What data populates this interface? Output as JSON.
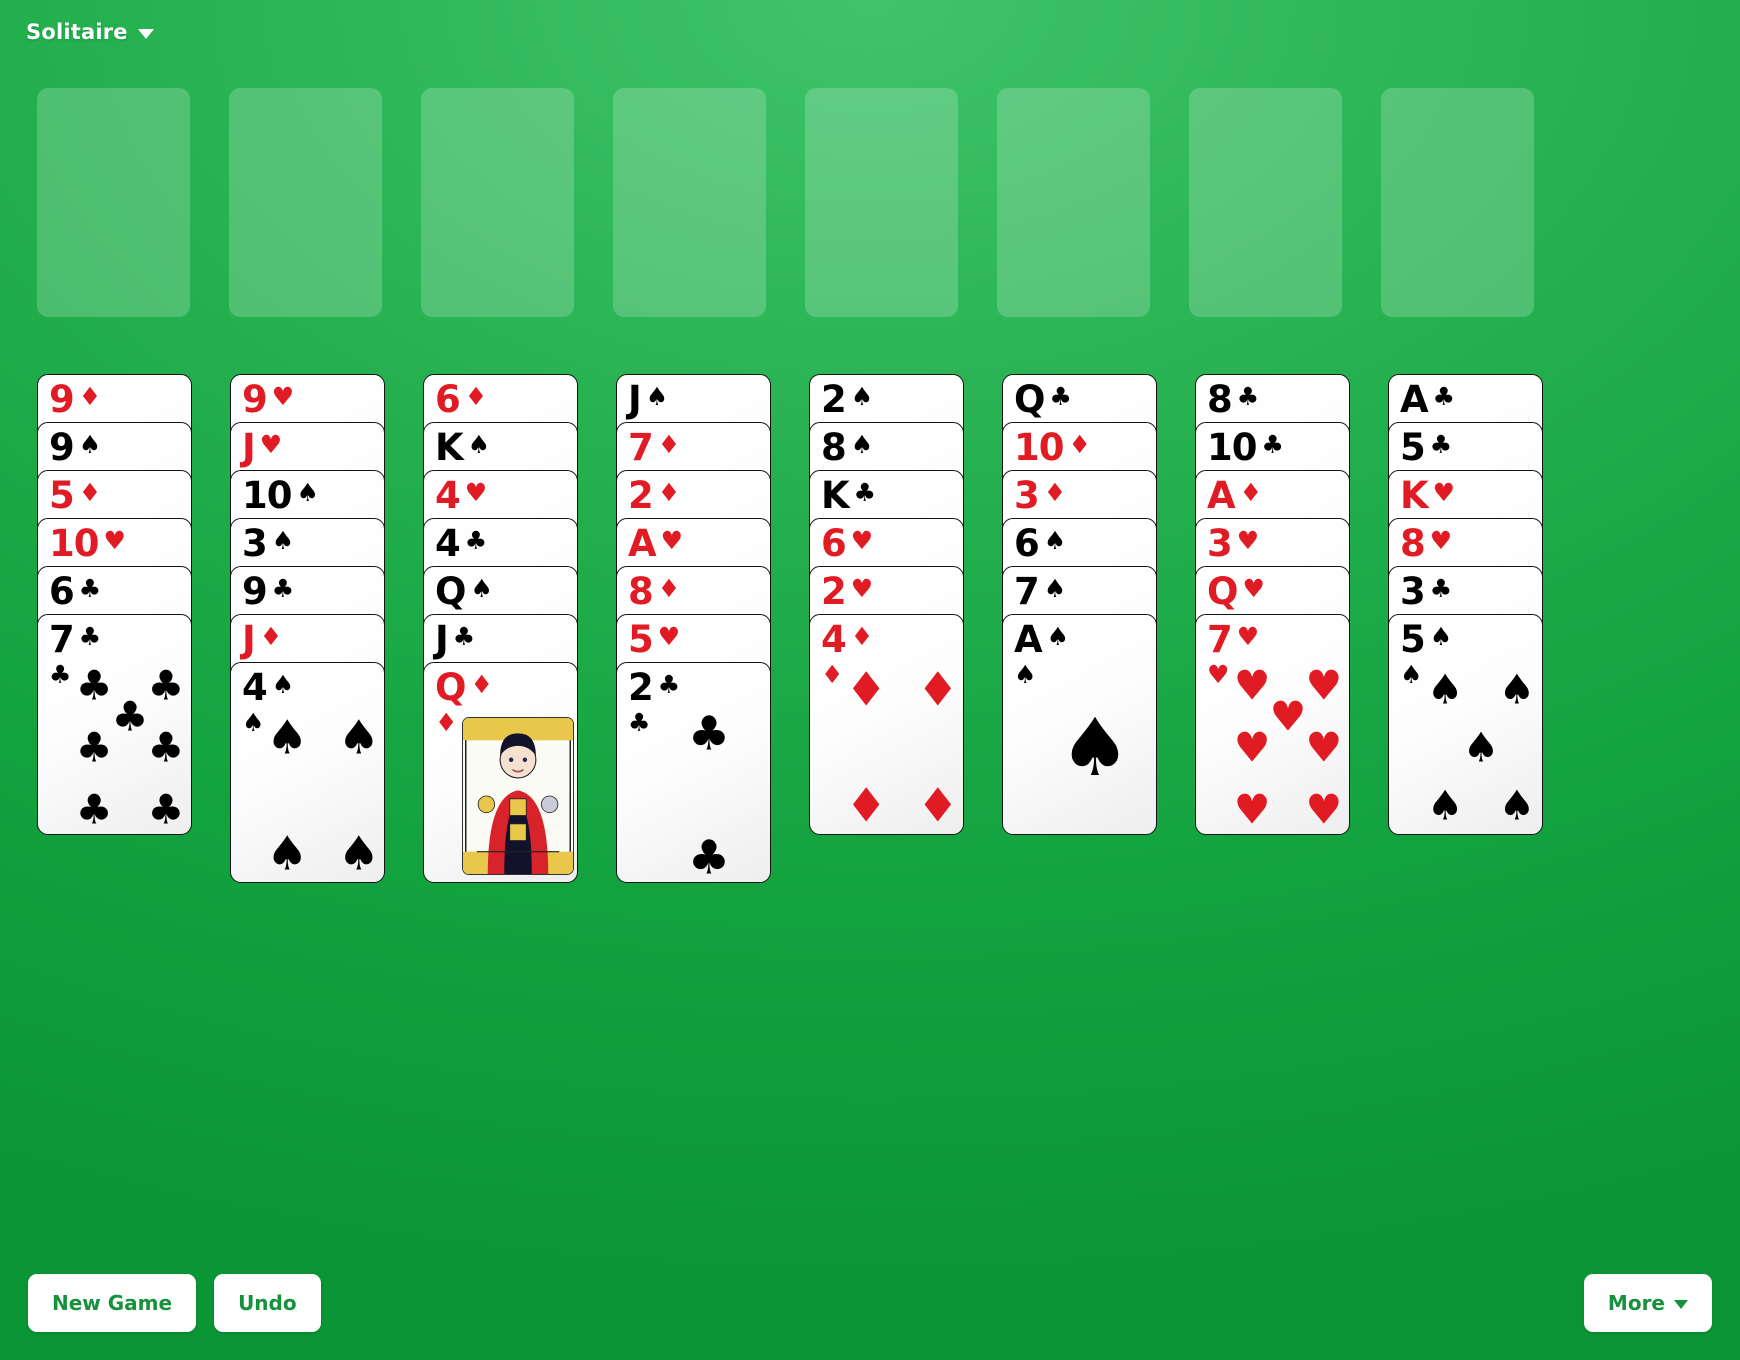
{
  "header": {
    "title": "Solitaire",
    "menu_caret": "chevron-down-icon"
  },
  "free_cells": {
    "count": 8,
    "cards": [
      null,
      null,
      null,
      null,
      null,
      null,
      null,
      null
    ]
  },
  "footer": {
    "new_game_label": "New Game",
    "undo_label": "Undo",
    "more_label": "More"
  },
  "colors": {
    "table_green": "#13a33f",
    "card_white": "#ffffff",
    "red_suit": "#e01b24",
    "black_suit": "#000000",
    "button_text": "#16913c"
  },
  "game": {
    "type": "freecell",
    "columns": [
      {
        "index": 1,
        "cards": [
          {
            "rank": "9",
            "suit": "♦",
            "suit_name": "diamonds",
            "color": "red"
          },
          {
            "rank": "9",
            "suit": "♠",
            "suit_name": "spades",
            "color": "black"
          },
          {
            "rank": "5",
            "suit": "♦",
            "suit_name": "diamonds",
            "color": "red"
          },
          {
            "rank": "10",
            "suit": "♥",
            "suit_name": "hearts",
            "color": "red"
          },
          {
            "rank": "6",
            "suit": "♣",
            "suit_name": "clubs",
            "color": "black"
          },
          {
            "rank": "7",
            "suit": "♣",
            "suit_name": "clubs",
            "color": "black"
          }
        ]
      },
      {
        "index": 2,
        "cards": [
          {
            "rank": "9",
            "suit": "♥",
            "suit_name": "hearts",
            "color": "red"
          },
          {
            "rank": "J",
            "suit": "♥",
            "suit_name": "hearts",
            "color": "red"
          },
          {
            "rank": "10",
            "suit": "♠",
            "suit_name": "spades",
            "color": "black"
          },
          {
            "rank": "3",
            "suit": "♠",
            "suit_name": "spades",
            "color": "black"
          },
          {
            "rank": "9",
            "suit": "♣",
            "suit_name": "clubs",
            "color": "black"
          },
          {
            "rank": "J",
            "suit": "♦",
            "suit_name": "diamonds",
            "color": "red"
          },
          {
            "rank": "4",
            "suit": "♠",
            "suit_name": "spades",
            "color": "black"
          }
        ]
      },
      {
        "index": 3,
        "cards": [
          {
            "rank": "6",
            "suit": "♦",
            "suit_name": "diamonds",
            "color": "red"
          },
          {
            "rank": "K",
            "suit": "♠",
            "suit_name": "spades",
            "color": "black"
          },
          {
            "rank": "4",
            "suit": "♥",
            "suit_name": "hearts",
            "color": "red"
          },
          {
            "rank": "4",
            "suit": "♣",
            "suit_name": "clubs",
            "color": "black"
          },
          {
            "rank": "Q",
            "suit": "♠",
            "suit_name": "spades",
            "color": "black"
          },
          {
            "rank": "J",
            "suit": "♣",
            "suit_name": "clubs",
            "color": "black"
          },
          {
            "rank": "Q",
            "suit": "♦",
            "suit_name": "diamonds",
            "color": "red"
          }
        ]
      },
      {
        "index": 4,
        "cards": [
          {
            "rank": "J",
            "suit": "♠",
            "suit_name": "spades",
            "color": "black"
          },
          {
            "rank": "7",
            "suit": "♦",
            "suit_name": "diamonds",
            "color": "red"
          },
          {
            "rank": "2",
            "suit": "♦",
            "suit_name": "diamonds",
            "color": "red"
          },
          {
            "rank": "A",
            "suit": "♥",
            "suit_name": "hearts",
            "color": "red"
          },
          {
            "rank": "8",
            "suit": "♦",
            "suit_name": "diamonds",
            "color": "red"
          },
          {
            "rank": "5",
            "suit": "♥",
            "suit_name": "hearts",
            "color": "red"
          },
          {
            "rank": "2",
            "suit": "♣",
            "suit_name": "clubs",
            "color": "black"
          }
        ]
      },
      {
        "index": 5,
        "cards": [
          {
            "rank": "2",
            "suit": "♠",
            "suit_name": "spades",
            "color": "black"
          },
          {
            "rank": "8",
            "suit": "♠",
            "suit_name": "spades",
            "color": "black"
          },
          {
            "rank": "K",
            "suit": "♣",
            "suit_name": "clubs",
            "color": "black"
          },
          {
            "rank": "6",
            "suit": "♥",
            "suit_name": "hearts",
            "color": "red"
          },
          {
            "rank": "2",
            "suit": "♥",
            "suit_name": "hearts",
            "color": "red"
          },
          {
            "rank": "4",
            "suit": "♦",
            "suit_name": "diamonds",
            "color": "red"
          }
        ]
      },
      {
        "index": 6,
        "cards": [
          {
            "rank": "Q",
            "suit": "♣",
            "suit_name": "clubs",
            "color": "black"
          },
          {
            "rank": "10",
            "suit": "♦",
            "suit_name": "diamonds",
            "color": "red"
          },
          {
            "rank": "3",
            "suit": "♦",
            "suit_name": "diamonds",
            "color": "red"
          },
          {
            "rank": "6",
            "suit": "♠",
            "suit_name": "spades",
            "color": "black"
          },
          {
            "rank": "7",
            "suit": "♠",
            "suit_name": "spades",
            "color": "black"
          },
          {
            "rank": "A",
            "suit": "♠",
            "suit_name": "spades",
            "color": "black"
          }
        ]
      },
      {
        "index": 7,
        "cards": [
          {
            "rank": "8",
            "suit": "♣",
            "suit_name": "clubs",
            "color": "black"
          },
          {
            "rank": "10",
            "suit": "♣",
            "suit_name": "clubs",
            "color": "black"
          },
          {
            "rank": "A",
            "suit": "♦",
            "suit_name": "diamonds",
            "color": "red"
          },
          {
            "rank": "3",
            "suit": "♥",
            "suit_name": "hearts",
            "color": "red"
          },
          {
            "rank": "Q",
            "suit": "♥",
            "suit_name": "hearts",
            "color": "red"
          },
          {
            "rank": "7",
            "suit": "♥",
            "suit_name": "hearts",
            "color": "red"
          }
        ]
      },
      {
        "index": 8,
        "cards": [
          {
            "rank": "A",
            "suit": "♣",
            "suit_name": "clubs",
            "color": "black"
          },
          {
            "rank": "5",
            "suit": "♣",
            "suit_name": "clubs",
            "color": "black"
          },
          {
            "rank": "K",
            "suit": "♥",
            "suit_name": "hearts",
            "color": "red"
          },
          {
            "rank": "8",
            "suit": "♥",
            "suit_name": "hearts",
            "color": "red"
          },
          {
            "rank": "3",
            "suit": "♣",
            "suit_name": "clubs",
            "color": "black"
          },
          {
            "rank": "5",
            "suit": "♠",
            "suit_name": "spades",
            "color": "black"
          }
        ]
      }
    ]
  }
}
